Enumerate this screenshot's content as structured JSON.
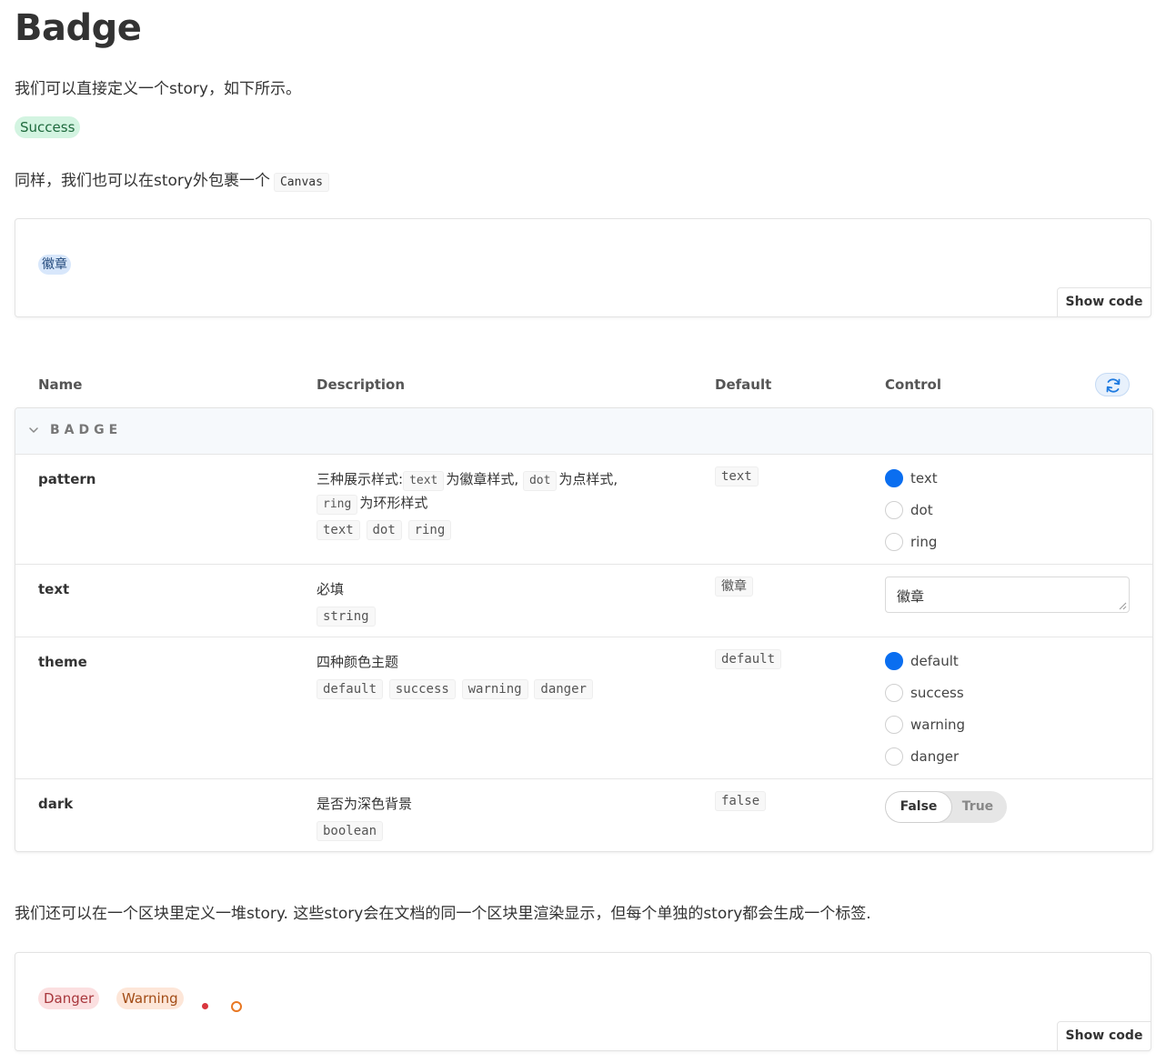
{
  "page": {
    "title": "Badge",
    "intro": "我们可以直接定义一个story，如下所示。",
    "canvas_intro": "同样，我们也可以在story外包裹一个",
    "canvas_code": "Canvas",
    "multi_intro": "我们还可以在一个区块里定义一堆story. 这些story会在文档的同一个区块里渲染显示，但每个单独的story都会生成一个标签."
  },
  "story_success": {
    "label": "Success"
  },
  "canvas1": {
    "badge_label": "徽章",
    "show_code": "Show code"
  },
  "args": {
    "headers": {
      "name": "Name",
      "description": "Description",
      "default": "Default",
      "control": "Control"
    },
    "section": "BADGE",
    "rows": {
      "pattern": {
        "name": "pattern",
        "desc_a": "三种展示样式:",
        "desc_code1": "text",
        "desc_b": "为徽章样式,",
        "desc_code2": "dot",
        "desc_c": "为点样式,",
        "desc_code3": "ring",
        "desc_d": "为环形样式",
        "types": [
          "text",
          "dot",
          "ring"
        ],
        "default": "text",
        "options": [
          "text",
          "dot",
          "ring"
        ],
        "selected": "text"
      },
      "text": {
        "name": "text",
        "desc": "必填",
        "type": "string",
        "default": "徽章",
        "value": "徽章"
      },
      "theme": {
        "name": "theme",
        "desc": "四种颜色主题",
        "types": [
          "default",
          "success",
          "warning",
          "danger"
        ],
        "default": "default",
        "options": [
          "default",
          "success",
          "warning",
          "danger"
        ],
        "selected": "default"
      },
      "dark": {
        "name": "dark",
        "desc": "是否为深色背景",
        "type": "boolean",
        "default": "false",
        "toggle_false": "False",
        "toggle_true": "True",
        "value": "False"
      }
    }
  },
  "canvas2": {
    "danger_label": "Danger",
    "warning_label": "Warning",
    "show_code": "Show code",
    "dot_color": "#d9363e",
    "ring_color": "#e87722"
  },
  "colors": {
    "accent": "#0a6ef0",
    "success_bg": "#d3f4e1",
    "danger_bg": "#fbdfe0",
    "warning_bg": "#fde6d8"
  }
}
